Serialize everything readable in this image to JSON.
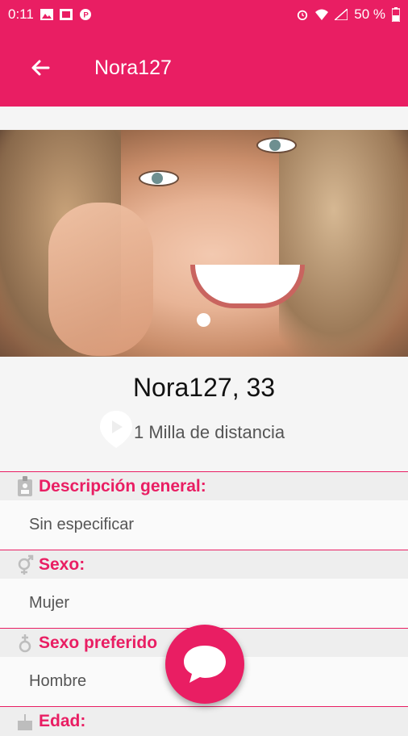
{
  "status_bar": {
    "time": "0:11",
    "battery": "50 %",
    "icons": [
      "gallery-icon",
      "image-icon",
      "p-icon",
      "alarm-icon",
      "wifi-icon",
      "signal-icon",
      "battery-icon"
    ]
  },
  "app_bar": {
    "title": "Nora127",
    "back_icon": "arrow-left-icon"
  },
  "profile": {
    "name_age": "Nora127, 33",
    "distance": "1 Milla de distancia",
    "photo_index": 1
  },
  "sections": [
    {
      "icon": "id-badge-icon",
      "label": "Descripción general:",
      "value": "Sin especificar"
    },
    {
      "icon": "gender-icon",
      "label": "Sexo:",
      "value": "Mujer"
    },
    {
      "icon": "preferred-gender-icon",
      "label": "Sexo preferido",
      "value": "Hombre"
    },
    {
      "icon": "cake-icon",
      "label": "Edad:",
      "value": ""
    }
  ],
  "fab": {
    "icon": "chat-bubble-icon"
  },
  "colors": {
    "primary": "#e91e63",
    "header_bg": "#eeeeee",
    "value_bg": "#fafafa"
  }
}
